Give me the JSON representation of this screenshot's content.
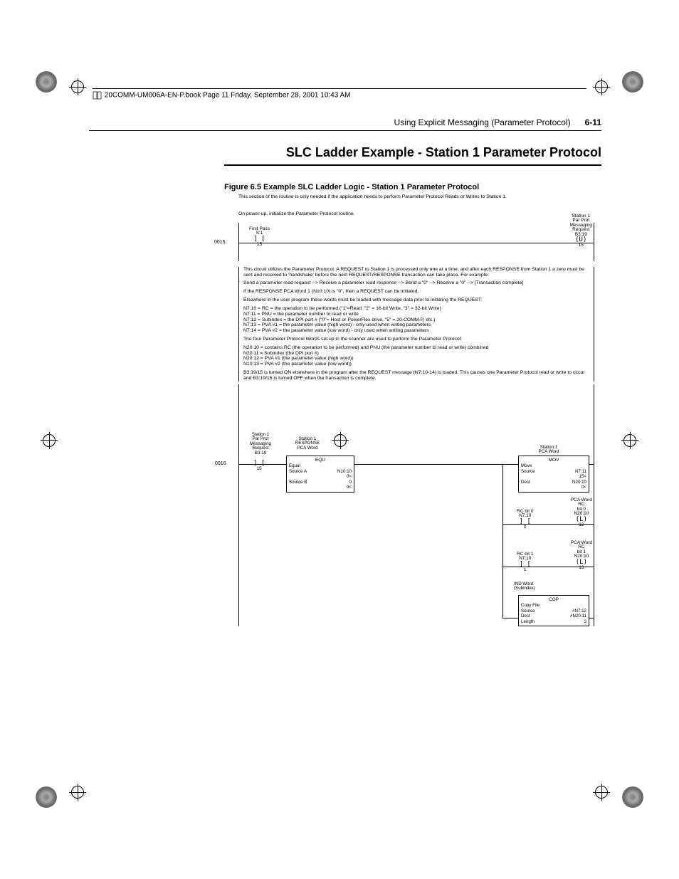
{
  "bookline": "20COMM-UM006A-EN-P.book  Page 11  Friday, September 28, 2001  10:43 AM",
  "header": {
    "chapter": "Using Explicit Messaging (Parameter Protocol)",
    "page": "6-11"
  },
  "section_title": "SLC Ladder Example - Station 1 Parameter Protocol",
  "figure_caption": "Figure 6.5   Example SLC Ladder Logic - Station 1 Parameter Protocol",
  "ladder": {
    "top_note": "This section of the routine is only needed if the application needs to perform Parameter Protocol Reads or Writes to Station 1.",
    "rung0015": {
      "num": "0015",
      "desc": "On power-up, initialize the Parameter Protocol routine.",
      "contact": {
        "label_top": "First Pass",
        "addr": "S:1",
        "bit": "15"
      },
      "coil": {
        "label_lines": [
          "Station 1",
          "Par Prot",
          "Messaging",
          "Request"
        ],
        "addr": "B3:19",
        "bit": "15",
        "type": "U"
      }
    },
    "notes": {
      "p1": "This circuit utilizes the Parameter Protocol.  A REQUEST to Station 1 is processed only one at a time, and after each RESPONSE from Station 1 a zero must be sent and received to 'handshake' before the next REQUEST/RESPONSE transaction can take place.  For example:",
      "p1b": "Send a parameter read request --> Receive a parameter read response --> Send a \"0\" --> Receive a \"0\" --> [Transaction complete]",
      "p2": "If the RESPONSE PCA Word 1 (N10:10) is \"0\", then a REQUEST can be initiated.",
      "p3a": "Elsewhere in the user program these words must be loaded with message data prior to initiating the REQUEST:",
      "p3_lines": [
        "N7:10 = RC = the operation to be performed (\"1\"=Read, \"2\" = 16-bit Write, \"3\" = 32-bit Write)",
        "N7:11 = PNU = the parameter number to read or write",
        "N7:12 = Subindex = the DPI port # (\"0\"= Host or PowerFlex drive, \"5\" = 20-COMM-P, etc.)",
        "N7:13 = PVA #1 = the parameter value (high word) - only used when writing parameters",
        "N7:14 = PVA #2 = the parameter value (low word) - only used when writing parameters"
      ],
      "p4a": "The four Parameter Protocol Words set up in the scanner are used to perform the Parameter Protocol:",
      "p4_lines": [
        "N20:10 = contains RC (the operation to be performed) and PNU (the parameter number to read or write) combined",
        "N20:11 = Subindex (the DPI port #)",
        "N20:12 = PVA #1 (the parameter value (high word))",
        "N10:13 = PVA #2 (the parameter value (low word))"
      ],
      "p5": "B3:19/15 is turned ON elsewhere in the program after the REQUEST message (N7:10-14) is loaded.  This causes one Parameter Protocol read or write to occur and B3:19/15 is turned OFF when the transaction is complete."
    },
    "rung0016": {
      "num": "0016",
      "contact": {
        "label_lines": [
          "Station 1",
          "Par Prot",
          "Messaging",
          "Request"
        ],
        "addr": "B3:19",
        "bit": "15"
      },
      "equ": {
        "label_lines": [
          "Station 1",
          "RESPONSE",
          "PCA Word"
        ],
        "title": "EQU",
        "name": "Equal",
        "srcA": "Source A",
        "srcA_v": "N10:10",
        "srcA_sub": "0<",
        "srcB": "Source B",
        "srcB_v": "0",
        "srcB_sub": "0<"
      },
      "mov": {
        "label_lines": [
          "Station 1",
          "PCA Word"
        ],
        "title": "MOV",
        "name": "Move",
        "src": "Source",
        "src_v": "N7:11",
        "src_sub": "15<",
        "dst": "Dest",
        "dst_v": "N20:10",
        "dst_sub": "0<"
      },
      "branch1": {
        "contact": {
          "label": "RC bit 0",
          "addr": "N7:10",
          "bit": "0"
        },
        "coil": {
          "label_lines": [
            "PCA Word",
            "RC",
            "bit 0"
          ],
          "addr": "N20:10",
          "bit": "12",
          "type": "L"
        }
      },
      "branch2": {
        "contact": {
          "label": "RC bit 1",
          "addr": "N7:10",
          "bit": "1"
        },
        "coil": {
          "label_lines": [
            "PCA Word",
            "RC",
            "bit 1"
          ],
          "addr": "N20:10",
          "bit": "13",
          "type": "L"
        }
      },
      "cop": {
        "label_lines": [
          "IND Word",
          "(Subindex)"
        ],
        "title": "COP",
        "name": "Copy File",
        "src": "Source",
        "src_v": "#N7:12",
        "dst": "Dest",
        "dst_v": "#N20:11",
        "len": "Length",
        "len_v": "3"
      }
    }
  }
}
